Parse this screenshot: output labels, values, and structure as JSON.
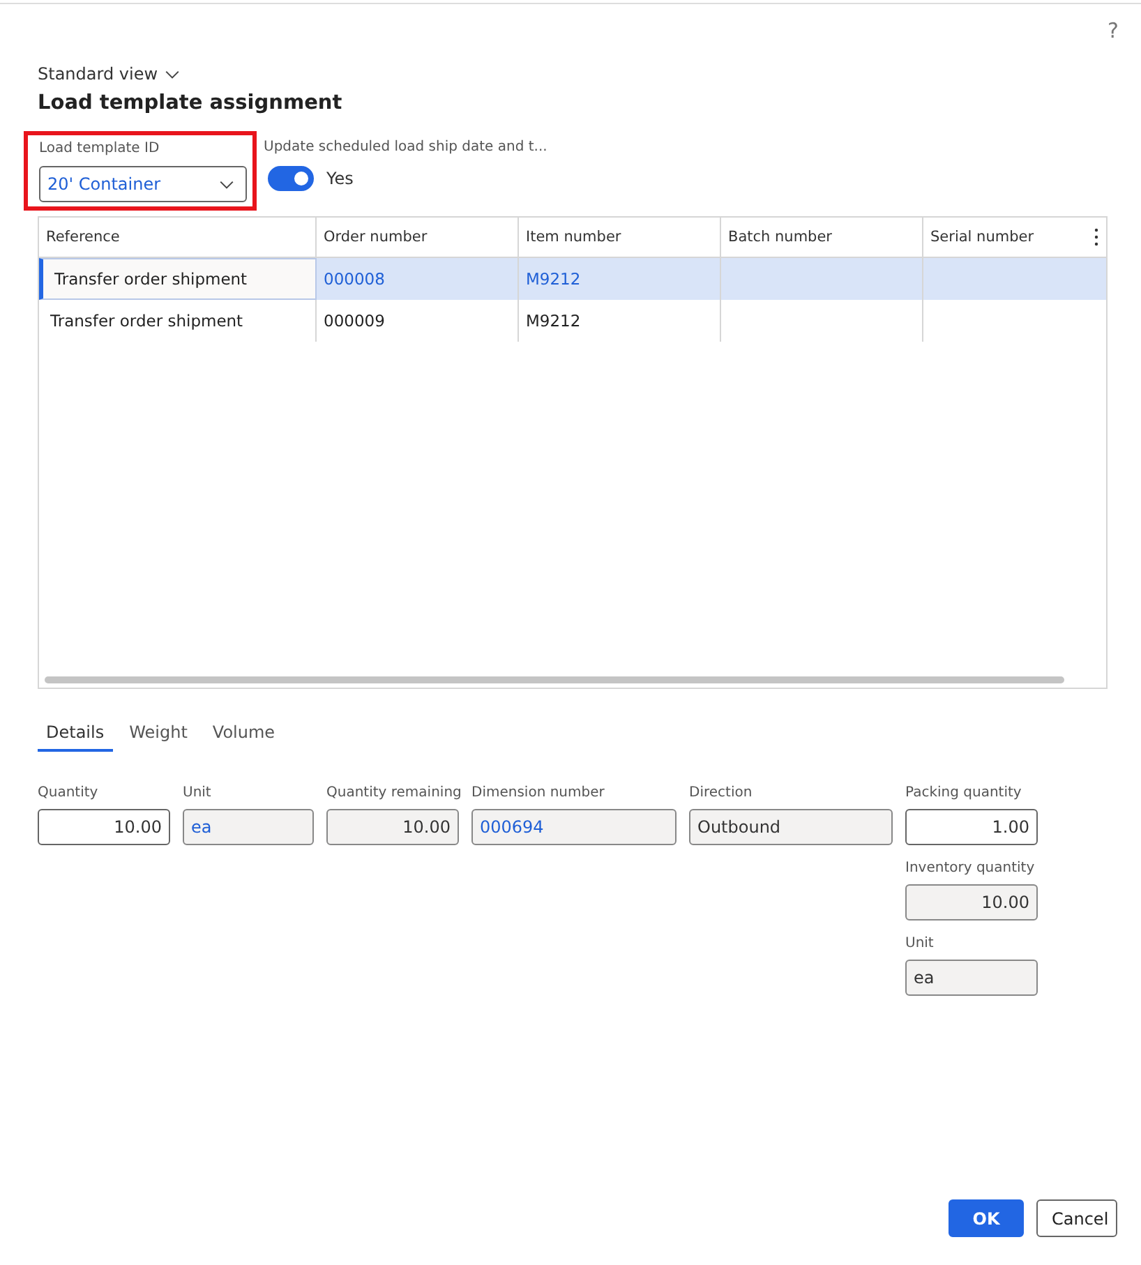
{
  "help": "?",
  "view": "Standard view",
  "title": "Load template assignment",
  "template_field": {
    "label": "Load template ID",
    "value": "20' Container",
    "highlighted": true
  },
  "toggle": {
    "label": "Update scheduled load ship date and t...",
    "on": true,
    "text": "Yes"
  },
  "table": {
    "columns": [
      "Reference",
      "Order number",
      "Item number",
      "Batch number",
      "Serial number"
    ],
    "rows": [
      {
        "selected": true,
        "cells": [
          "Transfer order shipment",
          "000008",
          "M9212",
          "",
          ""
        ]
      },
      {
        "selected": false,
        "cells": [
          "Transfer order shipment",
          "000009",
          "M9212",
          "",
          ""
        ]
      }
    ]
  },
  "tabs": [
    {
      "label": "Details",
      "selected": true
    },
    {
      "label": "Weight",
      "selected": false
    },
    {
      "label": "Volume",
      "selected": false
    }
  ],
  "fields": [
    {
      "label": "Quantity",
      "value": "10.00",
      "kind": "number",
      "readonly": false,
      "link": false
    },
    {
      "label": "Unit",
      "value": "ea",
      "kind": "text",
      "readonly": true,
      "link": true
    },
    {
      "label": "Quantity remaining",
      "value": "10.00",
      "kind": "number",
      "readonly": true,
      "link": false
    },
    {
      "label": "Dimension number",
      "value": "000694",
      "kind": "text",
      "readonly": true,
      "link": true
    },
    {
      "label": "Direction",
      "value": "Outbound",
      "kind": "text",
      "readonly": true,
      "link": false
    }
  ],
  "side_fields": [
    {
      "label": "Packing quantity",
      "value": "1.00",
      "kind": "number",
      "readonly": false,
      "link": false
    },
    {
      "label": "Inventory quantity",
      "value": "10.00",
      "kind": "number",
      "readonly": true,
      "link": false
    },
    {
      "label": "Unit",
      "value": "ea",
      "kind": "text",
      "readonly": true,
      "link": false
    }
  ],
  "buttons": [
    {
      "label": "OK",
      "kind": "primary"
    },
    {
      "label": "Cancel",
      "kind": "secondary"
    }
  ]
}
